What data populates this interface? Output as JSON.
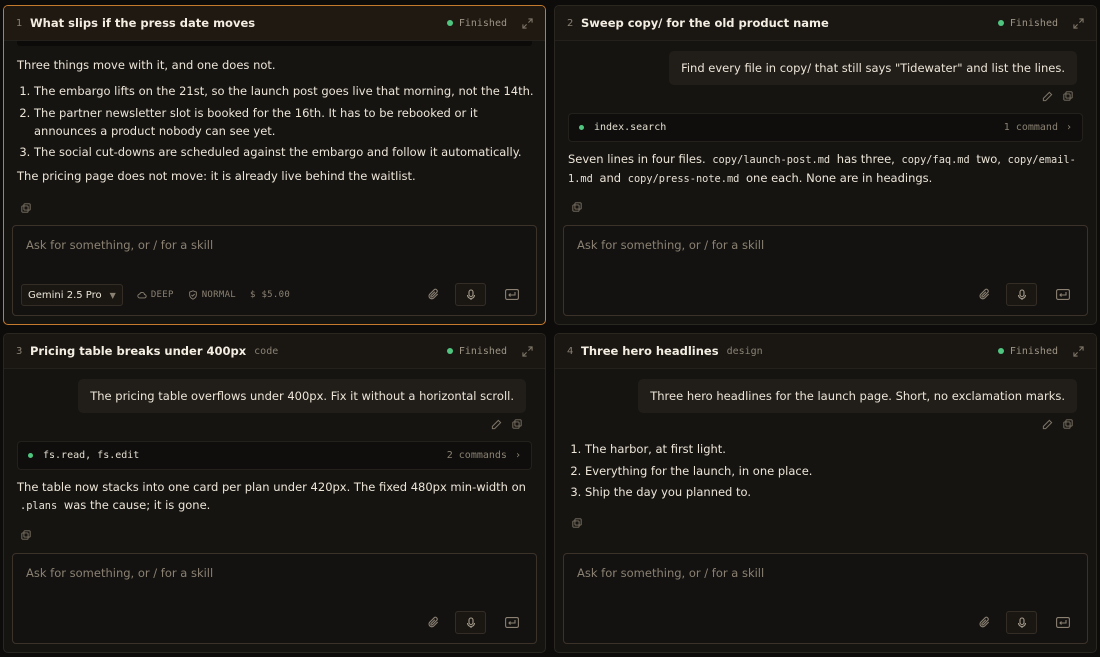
{
  "composer": {
    "placeholder": "Ask for something, or / for a skill",
    "model": "Gemini 2.5 Pro",
    "depth": "DEEP",
    "mode": "NORMAL",
    "budget": "$ $5.00"
  },
  "colors": {
    "accent": "#c47b2d",
    "status_green": "#4fc580"
  },
  "panes": [
    {
      "num": "1",
      "title": "What slips if the press date moves",
      "tag": "",
      "status": "Finished",
      "intro": "Three things move with it, and one does not.",
      "items": [
        "The embargo lifts on the 21st, so the launch post goes live that morning, not the 14th.",
        "The partner newsletter slot is booked for the 16th. It has to be rebooked or it announces a product nobody can see yet.",
        "The social cut-downs are scheduled against the embargo and follow it automatically."
      ],
      "outro": "The pricing page does not move: it is already live behind the waitlist."
    },
    {
      "num": "2",
      "title": "Sweep copy/ for the old product name",
      "tag": "",
      "status": "Finished",
      "prompt": "Find every file in copy/ that still says \"Tidewater\" and list the lines.",
      "command": {
        "name": "index.search",
        "count": "1 command"
      },
      "reply": {
        "t1": "Seven lines in four files.",
        "c1": "copy/launch-post.md",
        "t2": "has three,",
        "c2": "copy/faq.md",
        "t3": "two,",
        "c3": "copy/email-1.md",
        "t4": "and",
        "c4": "copy/press-note.md",
        "t5": "one each. None are in headings."
      }
    },
    {
      "num": "3",
      "title": "Pricing table breaks under 400px",
      "tag": "code",
      "status": "Finished",
      "prompt": "The pricing table overflows under 400px. Fix it without a horizontal scroll.",
      "command": {
        "name": "fs.read, fs.edit",
        "count": "2 commands"
      },
      "reply": {
        "t1": "The table now stacks into one card per plan under 420px. The fixed 480px min-width on",
        "c1": ".plans",
        "t2": "was the cause; it is gone."
      }
    },
    {
      "num": "4",
      "title": "Three hero headlines",
      "tag": "design",
      "status": "Finished",
      "prompt": "Three hero headlines for the launch page. Short, no exclamation marks.",
      "items": [
        "The harbor, at first light.",
        "Everything for the launch, in one place.",
        "Ship the day you planned to."
      ]
    }
  ]
}
